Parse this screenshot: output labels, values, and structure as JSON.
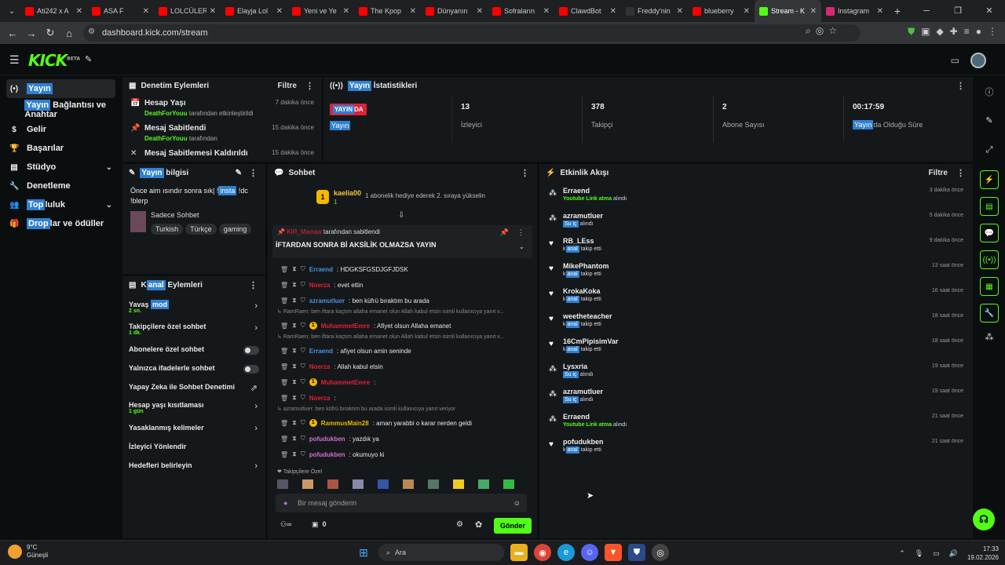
{
  "browser": {
    "tabs": [
      {
        "label": "Ati242 x A",
        "color": "#ff0000"
      },
      {
        "label": "ASA F",
        "color": "#ff0000"
      },
      {
        "label": "LOLCÜLER",
        "color": "#ff0000"
      },
      {
        "label": "Elayja Lol",
        "color": "#ff0000"
      },
      {
        "label": "Yeni ve Ye",
        "color": "#ff0000"
      },
      {
        "label": "The Kpop",
        "color": "#ff0000"
      },
      {
        "label": "Dünyanın",
        "color": "#ff0000"
      },
      {
        "label": "Sofraların",
        "color": "#ff0000"
      },
      {
        "label": "ClawdBot",
        "color": "#ff0000"
      },
      {
        "label": "Freddy'nin",
        "color": "#333333"
      },
      {
        "label": "blueberry",
        "color": "#ff0000"
      },
      {
        "label": "Stream - K",
        "color": "#53fc18"
      },
      {
        "label": "Instagram",
        "color": "#d62976"
      }
    ],
    "active_tab_index": 11,
    "url": "dashboard.kick.com/stream"
  },
  "header": {
    "logo": "KICK",
    "logo_sup": "BETA"
  },
  "sidebar": {
    "items": [
      {
        "pre": "",
        "hl": "Yayın",
        "post": "",
        "icon": "(•)"
      },
      {
        "pre": "",
        "hl": "Yayın",
        "post": " Bağlantısı ve Anahtar",
        "icon": ""
      },
      {
        "pre": "Gelir",
        "hl": "",
        "post": "",
        "icon": "$"
      },
      {
        "pre": "Başarılar",
        "hl": "",
        "post": "",
        "icon": "🏆"
      },
      {
        "pre": "Stüdyo",
        "hl": "",
        "post": "",
        "icon": "▤"
      },
      {
        "pre": "Denetleme",
        "hl": "",
        "post": "",
        "icon": "🔧"
      },
      {
        "pre": "",
        "hl": "Top",
        "post": "luluk",
        "icon": "👥"
      },
      {
        "pre": "",
        "hl": "Drop",
        "post": "lar ve ödüller",
        "icon": "🎁"
      }
    ]
  },
  "mod_actions": {
    "title": "Denetim Eylemleri",
    "filter": "Filtre",
    "items": [
      {
        "title": "Hesap Yaşı",
        "user": "DeathForYouu",
        "suffix": " tarafından etkinleştirildi",
        "time": "7 dakika önce",
        "icon": "📅"
      },
      {
        "title": "Mesaj Sabitlendi",
        "user": "DeathForYouu",
        "suffix": " tarafından",
        "time": "15 dakika önce",
        "icon": "📌"
      },
      {
        "title": "Mesaj Sabitlemesi Kaldırıldı",
        "user": "",
        "suffix": "",
        "time": "15 dakika önce",
        "icon": "✕"
      }
    ]
  },
  "stats": {
    "title_hl": "Yayın",
    "title_rest": " İstatistikleri",
    "live_hl": "YAYIN",
    "live_rest": "DA",
    "live_sub": "Yayın",
    "viewers": "13",
    "viewers_label": "İzleyici",
    "followers": "378",
    "followers_label": "Takipçi",
    "subs": "2",
    "subs_label": "Abone Sayısı",
    "uptime": "00:17:59",
    "uptime_hl": "Yayın",
    "uptime_rest": "da Olduğu Süre"
  },
  "stream_info": {
    "title_hl": "Yayın",
    "title_rest": " bilgisi",
    "text_a": "Önce aim ısındır sonra sık| !",
    "text_hl": "insta",
    "text_b": " !dc !blerp",
    "category": "Sadece Sohbet",
    "tags": [
      "Turkish",
      "Türkçe",
      "gaming"
    ]
  },
  "channel_actions": {
    "title_pre": "K",
    "title_hl": "anal",
    "title_rest": " Eylemleri",
    "items": [
      {
        "pre": "Yavaş ",
        "hl": "mod",
        "sub": "2 sn.",
        "ctl": "arrow"
      },
      {
        "pre": "Takipçilere özel sohbet",
        "hl": "",
        "sub": "1 dk.",
        "ctl": "arrow"
      },
      {
        "pre": "Abonelere özel sohbet",
        "hl": "",
        "sub": "",
        "ctl": "toggle"
      },
      {
        "pre": "Yalnızca ifadelerle sohbet",
        "hl": "",
        "sub": "",
        "ctl": "toggle"
      },
      {
        "pre": "Yapay Zeka ile Sohbet Denetimi",
        "hl": "",
        "sub": "",
        "ctl": "ext"
      },
      {
        "pre": "Hesap yaşı kısıtlaması",
        "hl": "",
        "sub": "1 gün",
        "ctl": "arrow"
      },
      {
        "pre": "Yasaklanmış kelimeler",
        "hl": "",
        "sub": "",
        "ctl": "arrow"
      },
      {
        "pre": "İzleyici Yönlendir",
        "hl": "",
        "sub": "",
        "ctl": ""
      },
      {
        "pre": "Hedefleri belirleyin",
        "hl": "",
        "sub": "",
        "ctl": "arrow"
      }
    ]
  },
  "chat": {
    "title": "Sohbet",
    "gift_user": "kaelia00",
    "gift_badge": "1",
    "gift_text": "1 abonelik hediye ederek 2. sıraya yükselin",
    "pinned_user": "KIR_Mamaa",
    "pinned_by": "tarafından sabitlendi",
    "pinned_text": "İFTARDAN SONRA Bİ AKSİLİK OLMAZSA YAYIN",
    "messages": [
      {
        "type": "msg",
        "user": "Erraend",
        "color": "#4a90e2",
        "text": ": HDGKSFGSDJGFJDSK"
      },
      {
        "type": "msg",
        "user": "Noerza",
        "color": "#e0203a",
        "text": ": evet ettin"
      },
      {
        "type": "msg",
        "user": "azramutluer",
        "color": "#4a90e2",
        "text": ": ben küfrü bıraktım bu arada"
      },
      {
        "type": "reply",
        "text": "RamRaen: ben iftara kaçtım allaha emanet olun Allah kabul etsin isimli kullanıcıya yanıt v..."
      },
      {
        "type": "msg",
        "user": "MuhammetEmre",
        "color": "#e0203a",
        "text": ": Afiyet olsun Allaha emanet",
        "badge": "1"
      },
      {
        "type": "reply",
        "text": "RamRaen: ben iftara kaçtım allaha emanet olun Allah kabul etsin isimli kullanıcıya yanıt v..."
      },
      {
        "type": "msg",
        "user": "Erraend",
        "color": "#4a90e2",
        "text": ": afiyet olsun amin seninde"
      },
      {
        "type": "msg",
        "user": "Noerza",
        "color": "#e0203a",
        "text": ": Allah kabul etsin"
      },
      {
        "type": "msg",
        "user": "MuhammetEmre",
        "color": "#e0203a",
        "text": ":",
        "badge": "1"
      },
      {
        "type": "msg",
        "user": "Noerza",
        "color": "#e0203a",
        "text": ":"
      },
      {
        "type": "reply",
        "text": "azramutluer: ben küfrü bıraktım bu arada isimli kullanıcıya yanıt veriyor"
      },
      {
        "type": "msg",
        "user": "RammusMain28",
        "color": "#e6b800",
        "text": ": aman yarabbi o karar nerden geldi",
        "badge": "1"
      },
      {
        "type": "msg",
        "user": "pofudukben",
        "color": "#d070d0",
        "text": ": yazdık ya"
      },
      {
        "type": "msg",
        "user": "pofudukben",
        "color": "#d070d0",
        "text": ": okumuyo ki"
      }
    ],
    "follower_only": "Takipçilere Özel",
    "placeholder": "Bir mesaj gönderin",
    "count": "0",
    "send": "Gönder"
  },
  "activity": {
    "title": "Etkinlik Akışı",
    "filter": "Filtre",
    "items": [
      {
        "name": "Erraend",
        "pre": "",
        "hl": "",
        "green": "Youtube Link atma",
        "post": " alındı",
        "time": "3 dakika önce",
        "icon": "gift"
      },
      {
        "name": "azramutluer",
        "pre": "",
        "hl": "Su iç",
        "green": "",
        "post": " alındı",
        "time": "5 dakika önce",
        "icon": "gift"
      },
      {
        "name": "RB_LEss",
        "pre": "k",
        "hl": "anal",
        "green": "",
        "post": " takip etti",
        "time": "9 dakika önce",
        "icon": "heart"
      },
      {
        "name": "MikePhantom",
        "pre": "k",
        "hl": "anal",
        "green": "",
        "post": " takip etti",
        "time": "13 saat önce",
        "icon": "heart"
      },
      {
        "name": "KrokaKoka",
        "pre": "k",
        "hl": "anal",
        "green": "",
        "post": " takip etti",
        "time": "16 saat önce",
        "icon": "heart"
      },
      {
        "name": "weetheteacher",
        "pre": "k",
        "hl": "anal",
        "green": "",
        "post": " takip etti",
        "time": "18 saat önce",
        "icon": "heart"
      },
      {
        "name": "16CmPipisimVar",
        "pre": "k",
        "hl": "anal",
        "green": "",
        "post": " takip etti",
        "time": "18 saat önce",
        "icon": "heart"
      },
      {
        "name": "Lysxria",
        "pre": "",
        "hl": "Su iç",
        "green": "",
        "post": " alındı",
        "time": "19 saat önce",
        "icon": "gift"
      },
      {
        "name": "azramutluer",
        "pre": "",
        "hl": "Su iç",
        "green": "",
        "post": " alındı",
        "time": "19 saat önce",
        "icon": "gift"
      },
      {
        "name": "Erraend",
        "pre": "",
        "hl": "",
        "green": "Youtube Link atma",
        "post": " alındı",
        "time": "21 saat önce",
        "icon": "gift"
      },
      {
        "name": "pofudukben",
        "pre": "k",
        "hl": "anal",
        "green": "",
        "post": " takip etti",
        "time": "21 saat önce",
        "icon": "heart"
      }
    ]
  },
  "taskbar": {
    "temp": "9°C",
    "weather": "Güneşli",
    "search": "Ara",
    "time": "17:33",
    "date": "19.02.2026"
  },
  "colors": {
    "accent": "#53fc18",
    "live": "#e0203a",
    "highlight": "#2f80d1"
  }
}
